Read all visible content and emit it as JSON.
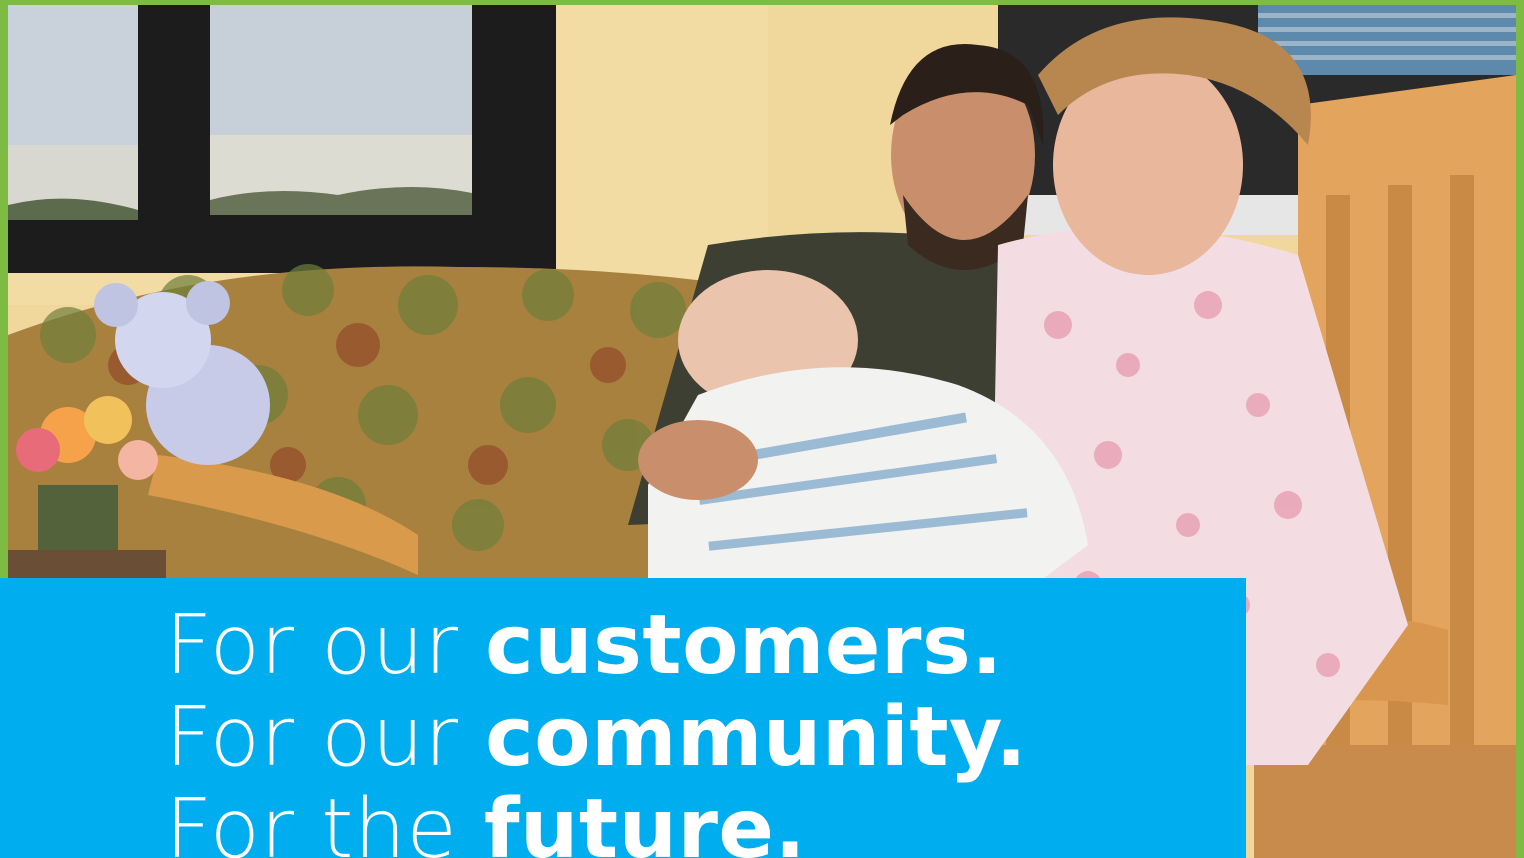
{
  "headline": {
    "line1": {
      "lead": "For our",
      "emphasis": "customers."
    },
    "line2": {
      "lead": "For our",
      "emphasis": "community."
    },
    "line3": {
      "lead": "For the",
      "emphasis": "future."
    }
  },
  "colors": {
    "frame": "#7dbb42",
    "banner": "#00aeef",
    "text": "#ffffff"
  }
}
